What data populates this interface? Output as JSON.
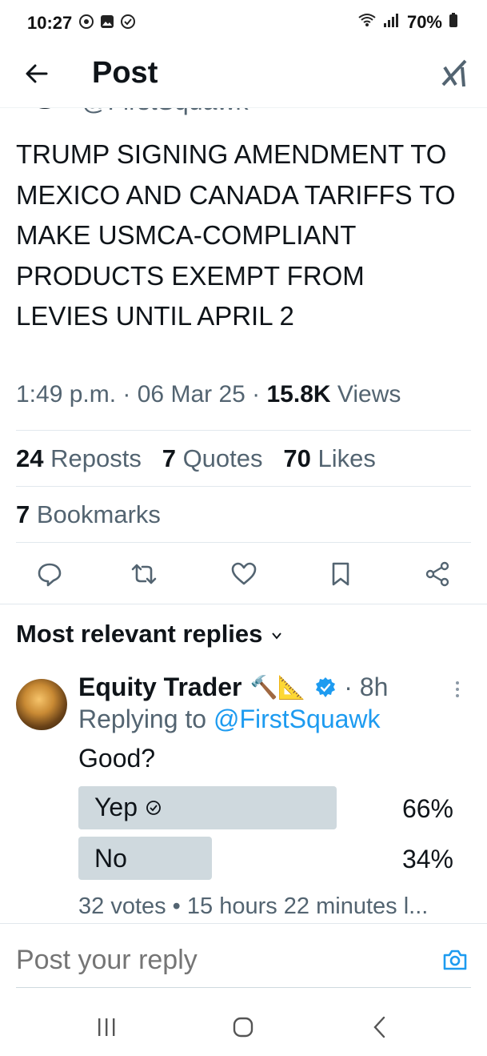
{
  "status_bar": {
    "time": "10:27",
    "battery": "70%"
  },
  "header": {
    "title": "Post"
  },
  "post": {
    "clipped_handle": "@FirstSquawk",
    "text": "TRUMP SIGNING AMENDMENT TO MEXICO AND CANADA TARIFFS TO MAKE USMCA-COMPLIANT PRODUCTS EXEMPT FROM LEVIES UNTIL APRIL 2",
    "time": "1:49 p.m.",
    "date": "06 Mar 25",
    "views_count": "15.8K",
    "views_label": "Views",
    "reposts_count": "24",
    "reposts_label": "Reposts",
    "quotes_count": "7",
    "quotes_label": "Quotes",
    "likes_count": "70",
    "likes_label": "Likes",
    "bookmarks_count": "7",
    "bookmarks_label": "Bookmarks"
  },
  "actions": [
    "reply-icon",
    "repost-icon",
    "like-icon",
    "bookmark-icon",
    "share-icon"
  ],
  "replies": {
    "heading": "Most relevant replies",
    "items": [
      {
        "name": "Equity Trader",
        "emoji": "🔨📐",
        "time": "8h",
        "replying_prefix": "Replying to",
        "replying_handle": "@FirstSquawk",
        "text": "Good?",
        "poll": {
          "options": [
            {
              "label": "Yep",
              "percent": "66%",
              "fill": 0.66,
              "selected": true
            },
            {
              "label": "No",
              "percent": "34%",
              "fill": 0.34,
              "selected": false
            }
          ],
          "footer": "32 votes • 15 hours 22 minutes l..."
        }
      }
    ]
  },
  "composer": {
    "placeholder": "Post your reply"
  },
  "colors": {
    "accent": "#1d9bf0",
    "text": "#0f1419",
    "muted": "#536471",
    "poll_fill": "#cfd9de"
  }
}
